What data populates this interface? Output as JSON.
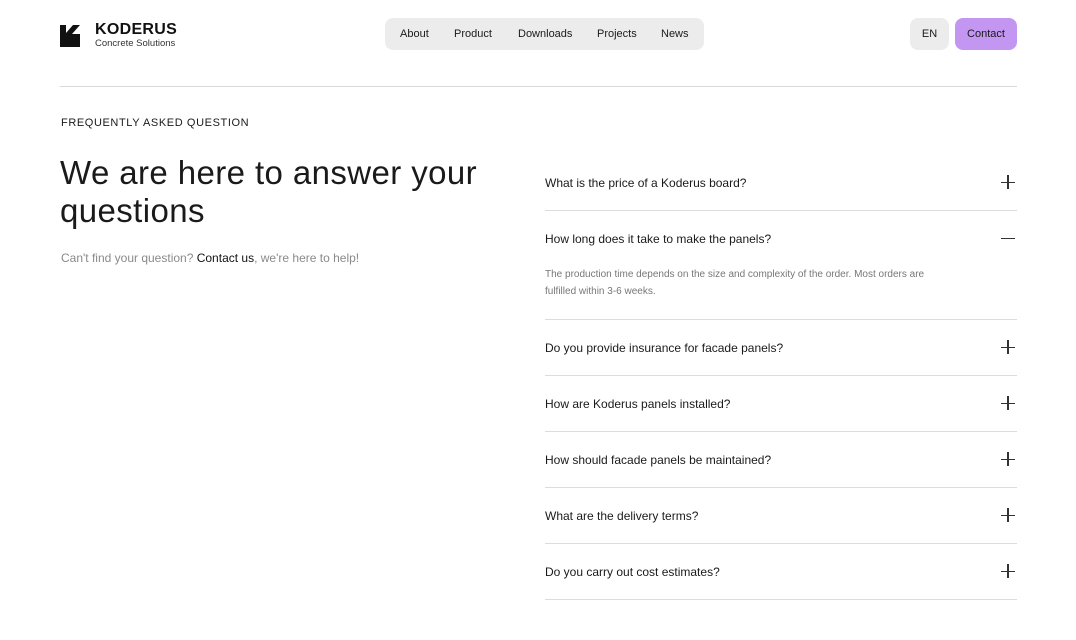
{
  "brand": {
    "name": "KODERUS",
    "tagline": "Concrete Solutions",
    "logo_icon": "koderus-k-logo"
  },
  "nav": {
    "items": [
      "About",
      "Product",
      "Downloads",
      "Projects",
      "News"
    ],
    "language": "EN",
    "contact_label": "Contact"
  },
  "faq_section": {
    "eyebrow": "FREQUENTLY ASKED QUESTION",
    "heading": "We are here to answer your questions",
    "sub_prefix": "Can't find your question? ",
    "sub_link": "Contact us",
    "sub_suffix": ", we're here to help!",
    "items": [
      {
        "question": "What is the price of a Koderus board?",
        "expanded": false
      },
      {
        "question": "How long does it take to make the panels?",
        "expanded": true,
        "answer": "The production time depends on the size and complexity of the order. Most orders are fulfilled within 3-6 weeks."
      },
      {
        "question": "Do you provide insurance for facade panels?",
        "expanded": false
      },
      {
        "question": "How are Koderus panels installed?",
        "expanded": false
      },
      {
        "question": "How should facade panels be maintained?",
        "expanded": false
      },
      {
        "question": "What are the delivery terms?",
        "expanded": false
      },
      {
        "question": "Do you carry out cost estimates?",
        "expanded": false
      }
    ]
  },
  "colors": {
    "accent": "#c396f2",
    "pill_bg": "#ececec",
    "divider": "#d9d9d9"
  }
}
